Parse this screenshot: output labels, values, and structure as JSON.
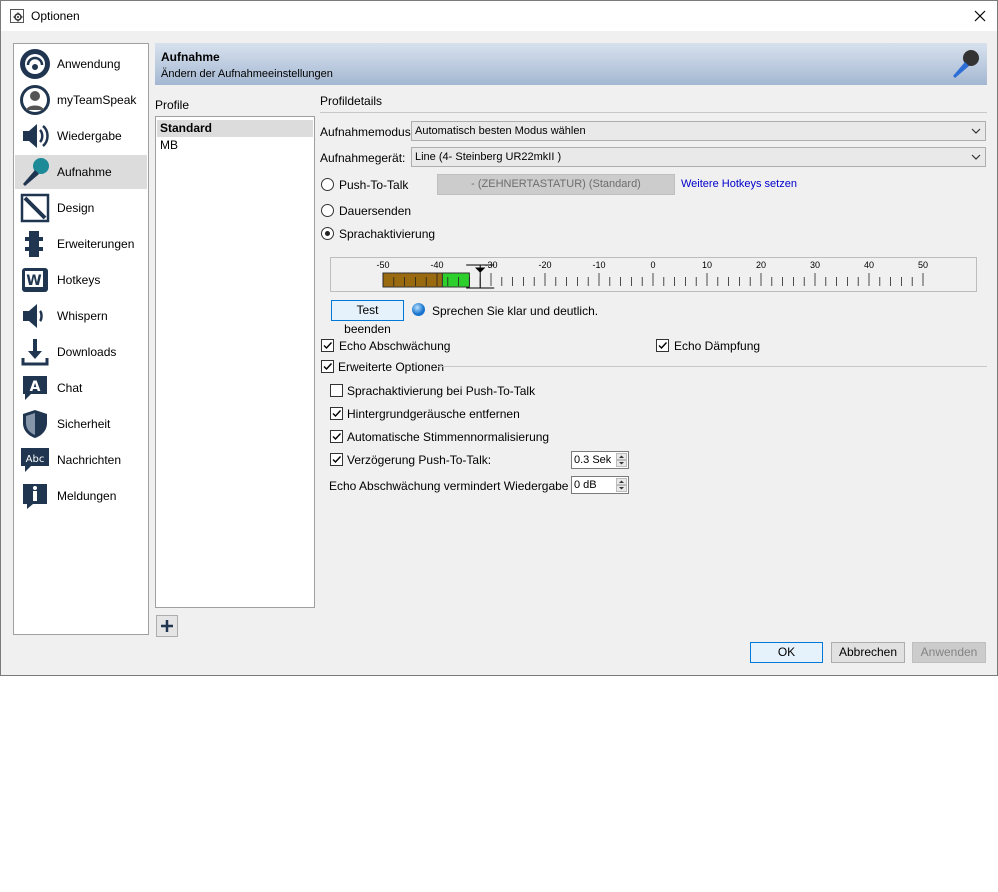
{
  "window": {
    "title": "Optionen"
  },
  "nav": {
    "items": [
      {
        "label": "Anwendung",
        "icon": "headset-icon"
      },
      {
        "label": "myTeamSpeak",
        "icon": "user-icon"
      },
      {
        "label": "Wiedergabe",
        "icon": "speaker-icon"
      },
      {
        "label": "Aufnahme",
        "icon": "microphone-icon"
      },
      {
        "label": "Design",
        "icon": "design-icon"
      },
      {
        "label": "Erweiterungen",
        "icon": "puzzle-icon"
      },
      {
        "label": "Hotkeys",
        "icon": "hotkey-icon"
      },
      {
        "label": "Whispern",
        "icon": "whisper-icon"
      },
      {
        "label": "Downloads",
        "icon": "download-icon"
      },
      {
        "label": "Chat",
        "icon": "chat-icon"
      },
      {
        "label": "Sicherheit",
        "icon": "shield-icon"
      },
      {
        "label": "Nachrichten",
        "icon": "message-icon"
      },
      {
        "label": "Meldungen",
        "icon": "info-icon"
      }
    ],
    "selected": "Aufnahme"
  },
  "header": {
    "title": "Aufnahme",
    "subtitle": "Ändern der Aufnahmeeinstellungen"
  },
  "profiles": {
    "label": "Profile",
    "items": [
      "Standard",
      "MB"
    ],
    "selected": "Standard"
  },
  "details": {
    "label": "Profildetails",
    "mode_label": "Aufnahmemodus:",
    "mode_value": "Automatisch besten Modus wählen",
    "device_label": "Aufnahmegerät:",
    "device_value": "Line (4- Steinberg UR22mkII )",
    "ptt_label": "Push-To-Talk",
    "ptt_hotkey": "- (ZEHNERTASTATUR) (Standard)",
    "more_hotkeys": "Weitere Hotkeys setzen",
    "continuous_label": "Dauersenden",
    "voice_activation_label": "Sprachaktivierung",
    "meter_ticks": [
      "-50",
      "-40",
      "-30",
      "-20",
      "-10",
      "0",
      "10",
      "20",
      "30",
      "40",
      "50"
    ],
    "meter_level_db": -34,
    "meter_threshold_db": -32,
    "test_button": "Test beenden",
    "test_hint": "Sprechen Sie klar und deutlich.",
    "echo_reduction": "Echo Abschwächung",
    "echo_cancellation": "Echo Dämpfung",
    "advanced": "Erweiterte Optionen",
    "va_with_ptt": "Sprachaktivierung bei Push-To-Talk",
    "remove_noise": "Hintergrundgeräusche entfernen",
    "auto_norm": "Automatische Stimmennormalisierung",
    "ptt_delay_label": "Verzögerung Push-To-Talk:",
    "ptt_delay_value": "0.3 Sek",
    "echo_playback_label": "Echo Abschwächung vermindert Wiedergabe um:",
    "echo_playback_value": "0 dB"
  },
  "buttons": {
    "ok": "OK",
    "cancel": "Abbrechen",
    "apply": "Anwenden"
  }
}
